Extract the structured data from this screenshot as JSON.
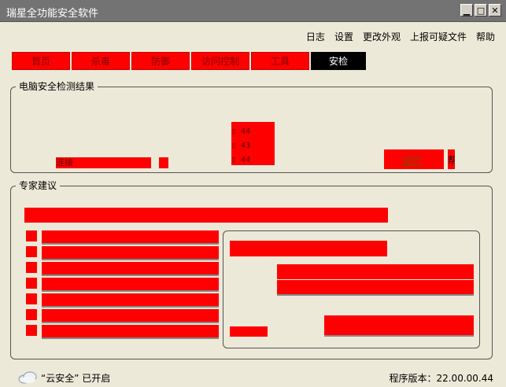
{
  "window": {
    "title": "瑞星全功能安全软件",
    "minimize": "▁",
    "maximize": "□",
    "close": "✕"
  },
  "menu": [
    "日志",
    "设置",
    "更改外观",
    "上报可疑文件",
    "帮助"
  ],
  "tabs": [
    "首页",
    "杀毒",
    "防御",
    "访问控制",
    "工具",
    "安检"
  ],
  "check_panel": {
    "legend": "电脑安全检测结果",
    "port_values": [
      "44",
      "43",
      "44"
    ],
    "connect_label": "连接",
    "run_button": "运行",
    "help_button": "帮"
  },
  "advice_panel": {
    "legend": "专家建议"
  },
  "status": {
    "cloud_text": "“云安全” 已开启",
    "version": "程序版本：22.00.00.44"
  },
  "colors": {
    "accent": "#ff0000",
    "background": "#ece9d8"
  }
}
